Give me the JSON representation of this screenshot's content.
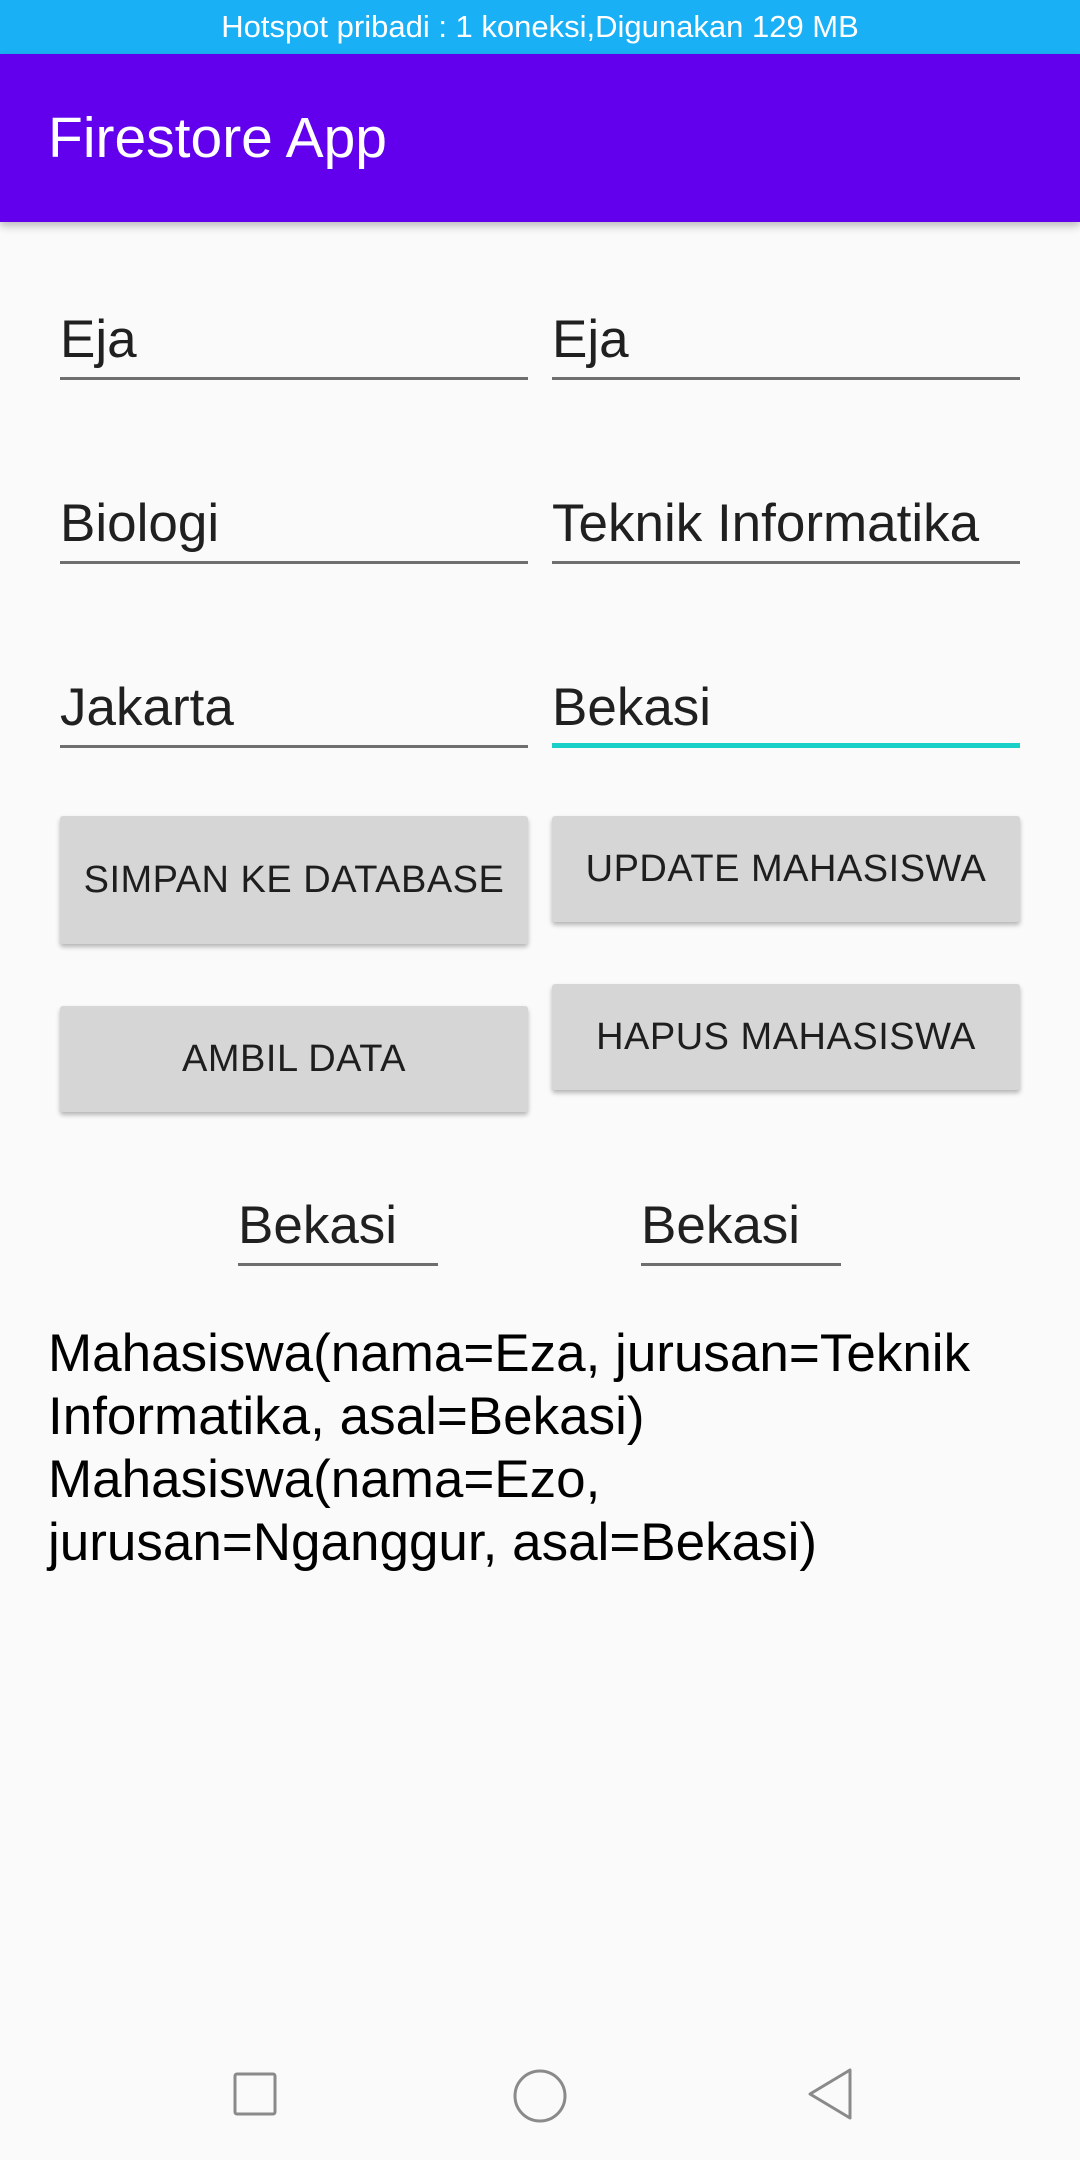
{
  "status_bar": {
    "text": "Hotspot pribadi : 1 koneksi,Digunakan 129 MB"
  },
  "app_bar": {
    "title": "Firestore App"
  },
  "form": {
    "nama_left": "Eja",
    "nama_right": "Eja",
    "jurusan_left": "Biologi",
    "jurusan_right": "Teknik Informatika",
    "asal_left": "Jakarta",
    "asal_right": "Bekasi"
  },
  "buttons": {
    "simpan": "SIMPAN KE DATABASE",
    "update": "UPDATE MAHASISWA",
    "ambil": "AMBIL DATA",
    "hapus": "HAPUS MAHASISWA"
  },
  "range_fields": {
    "left": "Bekasi",
    "right": "Bekasi"
  },
  "results": [
    "Mahasiswa(nama=Eza, jurusan=Teknik Informatika, asal=Bekasi)",
    "Mahasiswa(nama=Ezo, jurusan=Nganggur, asal=Bekasi)"
  ],
  "colors": {
    "status_bar": "#1ab0f5",
    "app_bar": "#6200ee",
    "focus_underline": "#19d0c8",
    "button_bg": "#d6d6d6"
  },
  "nav_bar": {
    "icons": [
      "square-recents-icon",
      "circle-home-icon",
      "triangle-back-icon"
    ]
  }
}
